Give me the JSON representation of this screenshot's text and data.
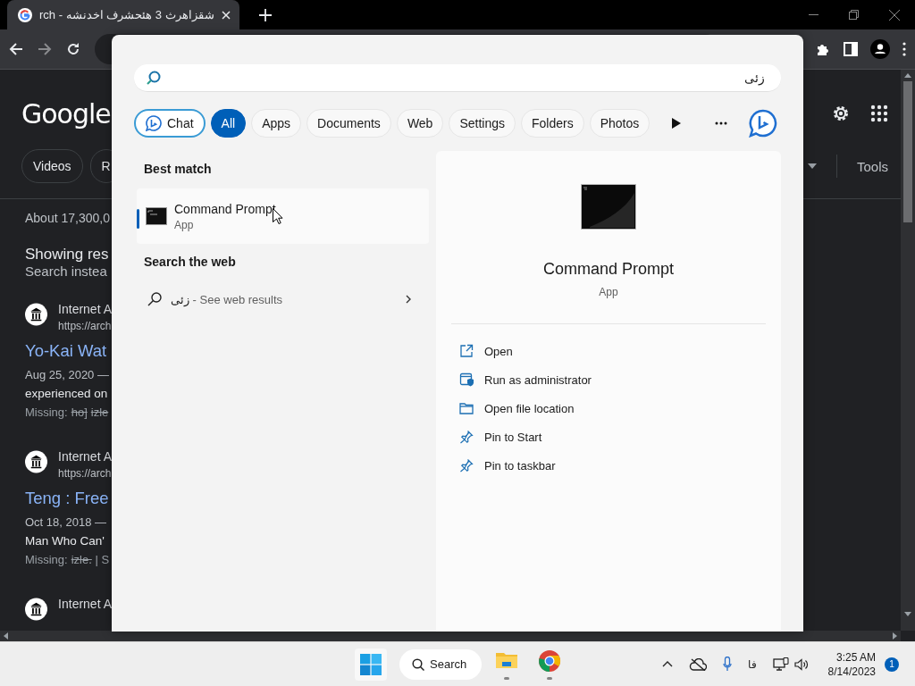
{
  "browser": {
    "tabs": [
      {
        "title": "شقزاهرث 3 هئحشرف اخدنشه - rch",
        "selected": true
      }
    ],
    "page": {
      "logo": "Google",
      "chips": [
        "Videos",
        "R"
      ],
      "tools": "Tools",
      "result_stats": "About 17,300,0",
      "spelling": {
        "showing": "Showing res",
        "instead": "Search instea"
      },
      "results": [
        {
          "source": "Internet A",
          "url": "https://arch",
          "title": "Yo-Kai Wat",
          "date": "Aug 25, 2020 —",
          "snippet": "experienced on",
          "missing": {
            "label": "Missing:",
            "terms": [
              "ho]",
              "izle"
            ]
          }
        },
        {
          "source": "Internet A",
          "url": "https://arch",
          "title": "Teng : Free",
          "date": "Oct 18, 2018 —",
          "snippet": "Man Who Can'",
          "missing": {
            "label": "Missing:",
            "terms": [
              "izle."
            ],
            "rest": "| S"
          }
        },
        {
          "source": "Internet A"
        }
      ]
    }
  },
  "start_search": {
    "query": "زئی",
    "filters": [
      {
        "label": "Chat",
        "kind": "chat",
        "selected": false
      },
      {
        "label": "All",
        "kind": "text",
        "selected": true
      },
      {
        "label": "Apps",
        "kind": "text",
        "selected": false
      },
      {
        "label": "Documents",
        "kind": "text",
        "selected": false
      },
      {
        "label": "Web",
        "kind": "text",
        "selected": false
      },
      {
        "label": "Settings",
        "kind": "text",
        "selected": false
      },
      {
        "label": "Folders",
        "kind": "text",
        "selected": false
      },
      {
        "label": "Photos",
        "kind": "text",
        "selected": false
      }
    ],
    "best_match_heading": "Best match",
    "best_match": {
      "title": "Command Prompt",
      "type": "App",
      "selected": true
    },
    "web_heading": "Search the web",
    "web_result": {
      "query": "زئی",
      "suffix": " - See web results",
      "selected": false
    },
    "preview": {
      "title": "Command Prompt",
      "type": "App",
      "actions": [
        {
          "label": "Open",
          "kind": "open"
        },
        {
          "label": "Run as administrator",
          "kind": "admin"
        },
        {
          "label": "Open file location",
          "kind": "folder"
        },
        {
          "label": "Pin to Start",
          "kind": "pin"
        },
        {
          "label": "Pin to taskbar",
          "kind": "pin"
        }
      ]
    }
  },
  "taskbar": {
    "search_label": "Search",
    "apps": [
      {
        "kind": "explorer",
        "running": true
      },
      {
        "kind": "chrome",
        "running": true
      }
    ],
    "ime": "فا",
    "time": "3:25 AM",
    "date": "8/14/2023",
    "notifications": "1"
  }
}
